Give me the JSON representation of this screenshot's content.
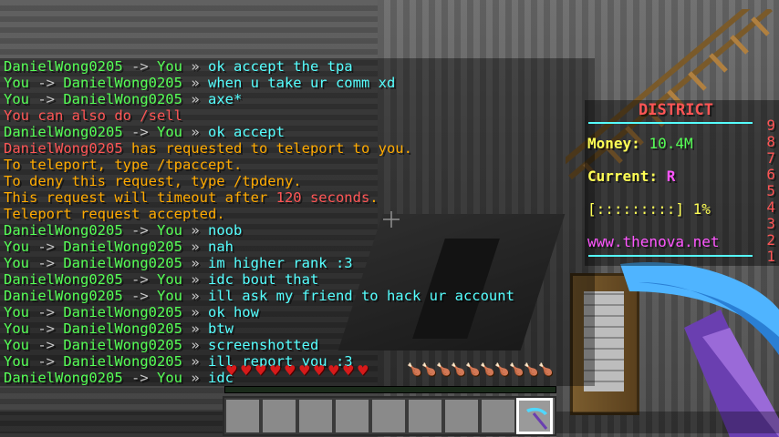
{
  "chat": {
    "lines": [
      {
        "from": "DanielWong0205",
        "arrow": "->",
        "to": "You",
        "msg": "ok accept the tpa",
        "from_color": "green",
        "to_color": "green",
        "msg_color": "aqua"
      },
      {
        "from": "You",
        "arrow": "->",
        "to": "DanielWong0205",
        "msg": "when u take ur comm xd",
        "from_color": "green",
        "to_color": "green",
        "msg_color": "aqua"
      },
      {
        "from": "You",
        "arrow": "->",
        "to": "DanielWong0205",
        "msg": "axe*",
        "from_color": "green",
        "to_color": "green",
        "msg_color": "aqua"
      },
      {
        "system": "You can also do /sell",
        "color": "red"
      },
      {
        "from": "DanielWong0205",
        "arrow": "->",
        "to": "You",
        "msg": "ok accept",
        "from_color": "green",
        "to_color": "green",
        "msg_color": "aqua"
      },
      {
        "system_parts": [
          {
            "text": "DanielWong0205",
            "color": "red"
          },
          {
            "text": " has requested to teleport to you.",
            "color": "gold"
          }
        ]
      },
      {
        "system": "To teleport, type /tpaccept.",
        "color": "gold"
      },
      {
        "system": "To deny this request, type /tpdeny.",
        "color": "gold"
      },
      {
        "system_parts": [
          {
            "text": "This request will timeout after ",
            "color": "gold"
          },
          {
            "text": "120 seconds",
            "color": "red"
          },
          {
            "text": ".",
            "color": "gold"
          }
        ]
      },
      {
        "system": "Teleport request accepted.",
        "color": "gold"
      },
      {
        "from": "DanielWong0205",
        "arrow": "->",
        "to": "You",
        "msg": "noob",
        "from_color": "green",
        "to_color": "green",
        "msg_color": "aqua"
      },
      {
        "from": "You",
        "arrow": "->",
        "to": "DanielWong0205",
        "msg": "nah",
        "from_color": "green",
        "to_color": "green",
        "msg_color": "aqua"
      },
      {
        "from": "You",
        "arrow": "->",
        "to": "DanielWong0205",
        "msg": "im higher rank :3",
        "from_color": "green",
        "to_color": "green",
        "msg_color": "aqua"
      },
      {
        "from": "DanielWong0205",
        "arrow": "->",
        "to": "You",
        "msg": "idc bout that",
        "from_color": "green",
        "to_color": "green",
        "msg_color": "aqua"
      },
      {
        "from": "DanielWong0205",
        "arrow": "->",
        "to": "You",
        "msg": "ill ask my friend to hack ur account",
        "from_color": "green",
        "to_color": "green",
        "msg_color": "aqua"
      },
      {
        "from": "You",
        "arrow": "->",
        "to": "DanielWong0205",
        "msg": "ok how",
        "from_color": "green",
        "to_color": "green",
        "msg_color": "aqua"
      },
      {
        "from": "You",
        "arrow": "->",
        "to": "DanielWong0205",
        "msg": "btw",
        "from_color": "green",
        "to_color": "green",
        "msg_color": "aqua"
      },
      {
        "from": "You",
        "arrow": "->",
        "to": "DanielWong0205",
        "msg": "screenshotted",
        "from_color": "green",
        "to_color": "green",
        "msg_color": "aqua"
      },
      {
        "from": "You",
        "arrow": "->",
        "to": "DanielWong0205",
        "msg": "ill report you :3",
        "from_color": "green",
        "to_color": "green",
        "msg_color": "aqua"
      },
      {
        "from": "DanielWong0205",
        "arrow": "->",
        "to": "You",
        "msg": "idc",
        "from_color": "green",
        "to_color": "green",
        "msg_color": "aqua"
      }
    ],
    "separator": "»"
  },
  "scoreboard": {
    "title": "DISTRICT",
    "money_label": "Money:",
    "money_value": "10.4M",
    "current_label": "Current:",
    "current_value": "R",
    "progress_text": "[:::::::::] 1%",
    "progress_percent": 1,
    "website": "www.thenova.net",
    "numbers": [
      "9",
      "8",
      "7",
      "6",
      "5",
      "4",
      "3",
      "2",
      "1"
    ]
  },
  "hud": {
    "hearts": 10,
    "hunger": 10,
    "xp_fraction": 0.0,
    "hotbar_selected": 8,
    "hotbar_slots": 9,
    "selected_item_icon": "diamond-pickaxe-icon"
  },
  "colors": {
    "green": "#55ff55",
    "aqua": "#55ffff",
    "red": "#ff5555",
    "gold": "#ffaa00",
    "gray": "#c6c6c6",
    "yellow": "#ffff55",
    "pink": "#ff55ff"
  }
}
